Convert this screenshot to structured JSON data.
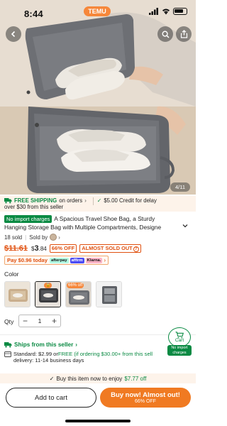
{
  "status_bar": {
    "time": "8:44",
    "app_pill": "TEMU"
  },
  "hero": {
    "image_counter": "4/11"
  },
  "shipping_strip": {
    "free_label": "FREE SHIPPING",
    "free_rest": "on orders",
    "line2": "over $30 from this seller",
    "credit": "$5.00 Credit for delay"
  },
  "product": {
    "badge": "No import charges",
    "title_line1": "A Spacious Travel Shoe Bag, a Sturdy",
    "title_line2": "Hanging Storage Bag with Multiple Compartments, Designe",
    "sold": "18 sold",
    "sold_by": "Sold by"
  },
  "price": {
    "old": "$11.61",
    "new_prefix": "$",
    "new_int": "3",
    "new_dec": ".84",
    "pct_off": "66% OFF",
    "sold_out": "ALMOST SOLD OUT"
  },
  "pay": {
    "text": "Pay $0.96 today",
    "klarna": "Klarna.",
    "afterpay": "afterpay",
    "affirm": "affirm"
  },
  "color": {
    "label": "Color",
    "swatches": [
      {
        "name": "beige"
      },
      {
        "name": "black",
        "tag": ""
      },
      {
        "name": "grey",
        "tag": "66% off"
      },
      {
        "name": "grey-dark"
      }
    ]
  },
  "qty": {
    "label": "Qty",
    "minus": "−",
    "value": "1",
    "plus": "+"
  },
  "ships": {
    "title": "Ships from this seller",
    "standard": "Standard: $2.99 or ",
    "free_part": "FREE (if ordering $30.00+ from this sell",
    "delivery": "delivery: 11-14 business days"
  },
  "cart_float": {
    "label": "Cart",
    "tag": "No import charges"
  },
  "bottom": {
    "strip_text": "Buy this item now to enjoy",
    "strip_amount": "$7.77 off",
    "add_to_cart": "Add to cart",
    "buy_now": "Buy now! Almost out!",
    "buy_sub": "66% OFF"
  },
  "colors": {
    "accent": "#f07a22",
    "green": "#0a8a43",
    "price_red": "#e0500f"
  }
}
